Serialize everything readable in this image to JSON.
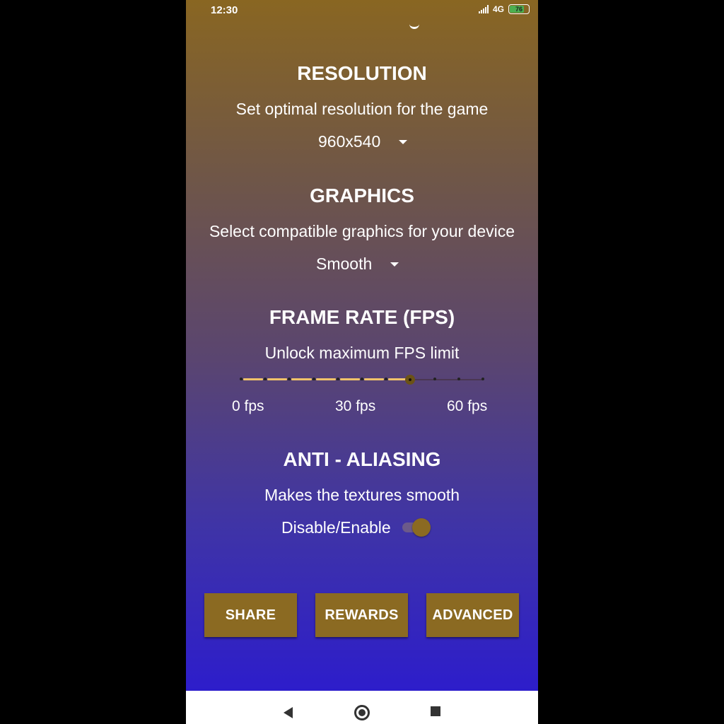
{
  "status_bar": {
    "time": "12:30",
    "network": "4G",
    "battery": "76"
  },
  "resolution": {
    "title": "RESOLUTION",
    "description": "Set optimal resolution for the game",
    "selected": "960x540"
  },
  "graphics": {
    "title": "GRAPHICS",
    "description": "Select compatible graphics for your device",
    "selected": "Smooth"
  },
  "frame_rate": {
    "title": "FRAME RATE (FPS)",
    "description": "Unlock maximum FPS limit",
    "labels": [
      "0 fps",
      "30 fps",
      "60 fps"
    ],
    "value_fraction": 0.7
  },
  "anti_aliasing": {
    "title": "ANTI - ALIASING",
    "description": "Makes the textures smooth",
    "toggle_label": "Disable/Enable",
    "enabled": true
  },
  "buttons": {
    "share": "SHARE",
    "rewards": "REWARDS",
    "advanced": "ADVANCED"
  },
  "colors": {
    "accent": "#8b6a22",
    "slider_active": "#f0c36a",
    "gradient_top": "#896622",
    "gradient_bottom": "#2d1dcb"
  }
}
